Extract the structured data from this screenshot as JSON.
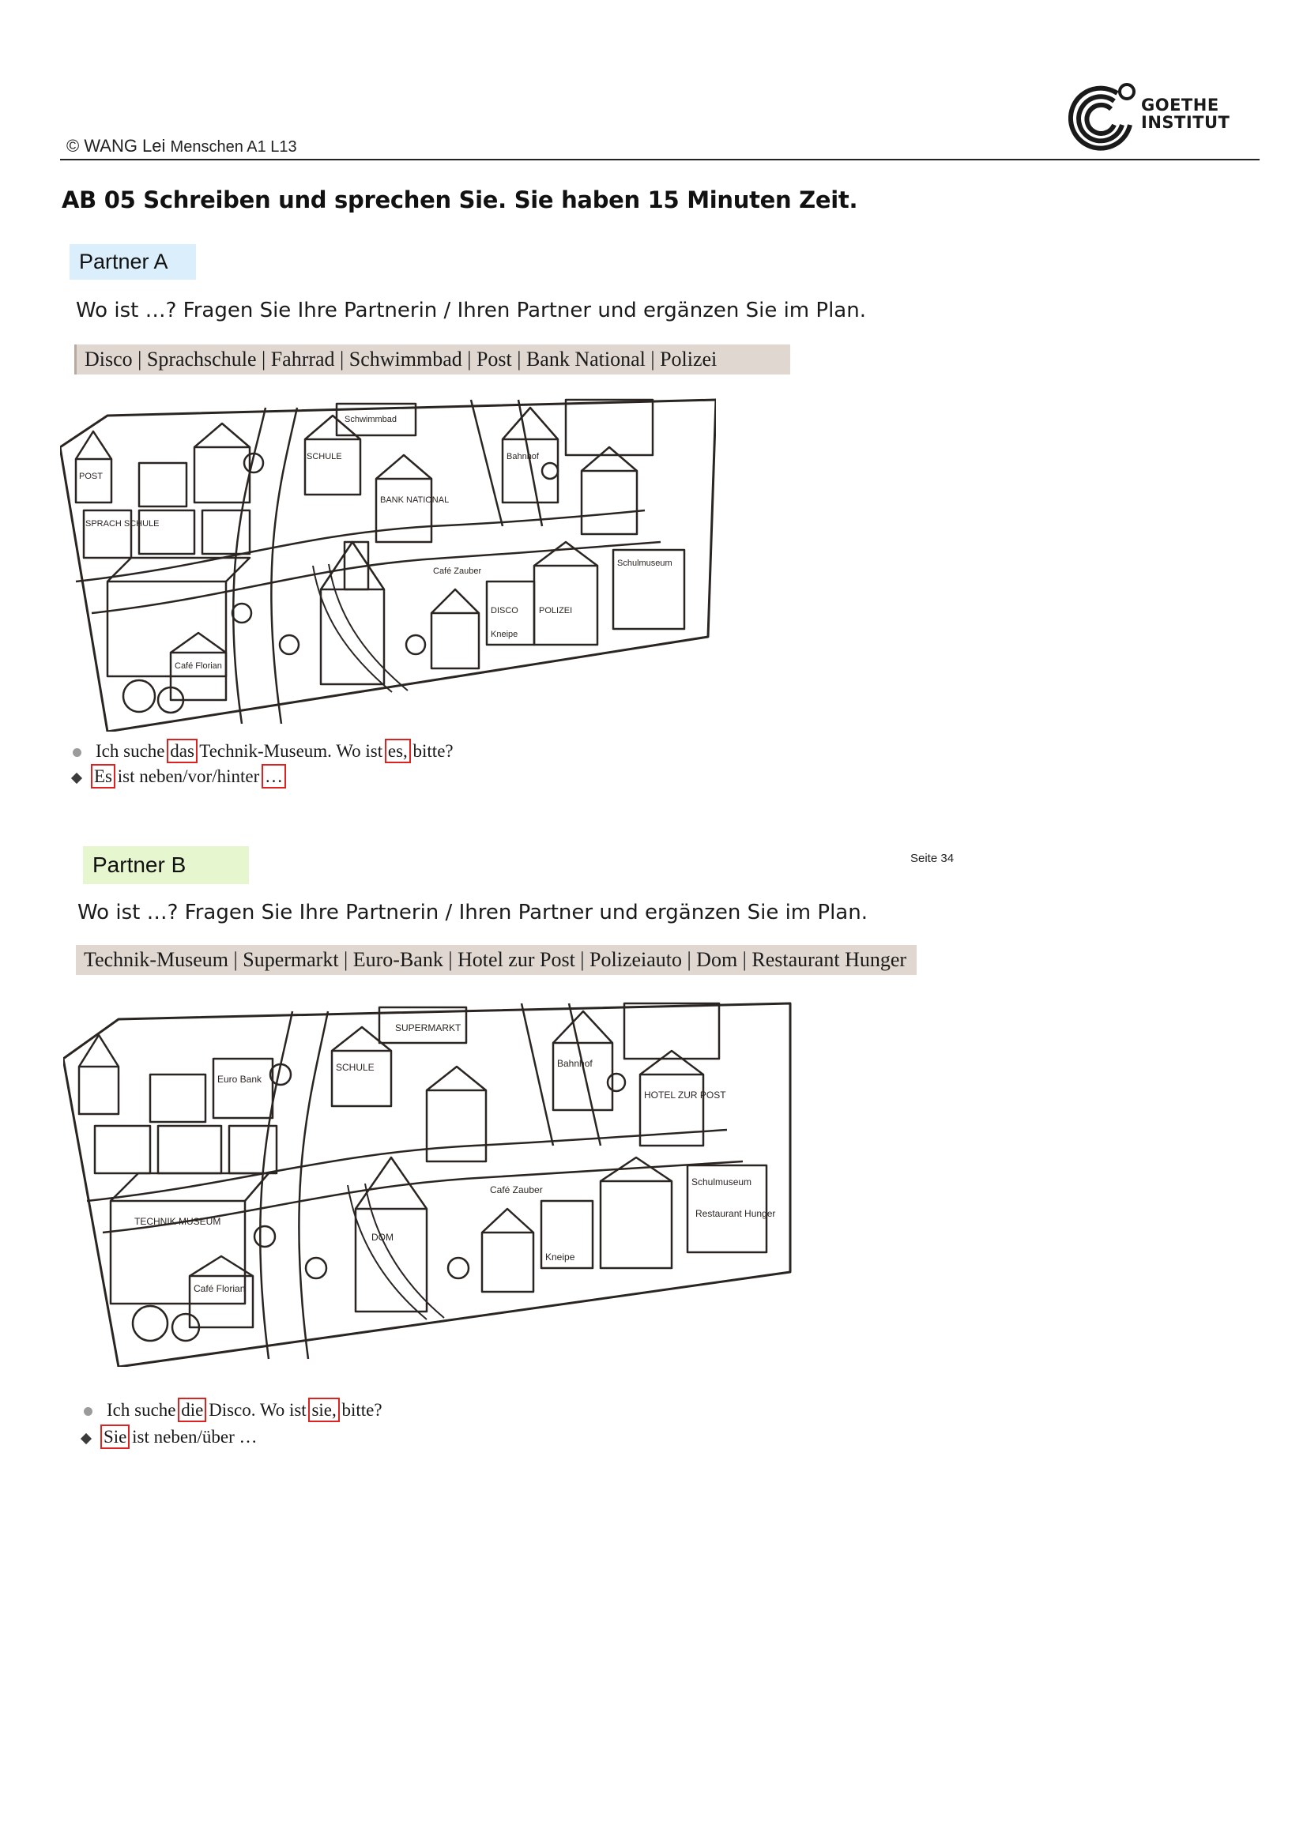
{
  "header": {
    "copyright": "© WANG Lei",
    "course": "Menschen A1 L13",
    "logo_line1": "GOETHE",
    "logo_line2": "INSTITUT"
  },
  "title": "AB 05 Schreiben und sprechen Sie. Sie haben 15  Minuten Zeit.",
  "partner_a": {
    "label": "Partner A",
    "instruction": "Wo ist …? Fragen Sie Ihre Partnerin / Ihren Partner und ergänzen Sie im Plan.",
    "words": "Disco | Sprachschule | Fahrrad | Schwimmbad | Post | Bank National | Polizei",
    "map_labels": [
      "POST",
      "SPRACH SCHULE",
      "SCHULE",
      "Schwimmbad",
      "BANK NATIONAL",
      "Café Zauber",
      "DISCO",
      "POLIZEI",
      "Kneipe",
      "Schulmuseum",
      "Café Florian",
      "Bahnhof"
    ],
    "dialog": {
      "q_pre": "Ich suche ",
      "q_art": "das",
      "q_mid": " Technik-Museum. Wo ist ",
      "q_pron": "es,",
      "q_post": " bitte?",
      "a_pron": "Es",
      "a_mid": " ist neben/vor/hinter ",
      "a_end": "…"
    }
  },
  "partner_b": {
    "label": "Partner B",
    "page_ref": "Seite 34",
    "instruction": "Wo ist …? Fragen Sie Ihre Partnerin / Ihren Partner und ergänzen Sie im Plan.",
    "words": "Technik-Museum | Supermarkt | Euro-Bank | Hotel zur Post | Polizeiauto | Dom | Restaurant Hunger",
    "map_labels": [
      "Euro Bank",
      "SCHULE",
      "SUPERMARKT",
      "TECHNIK MUSEUM",
      "Café Zauber",
      "DOM",
      "Kneipe",
      "Schulmuseum",
      "Restaurant Hunger",
      "HOTEL ZUR POST",
      "Café Florian",
      "Bahnhof"
    ],
    "dialog": {
      "q_pre": "Ich suche ",
      "q_art": "die",
      "q_mid": " Disco. Wo ist ",
      "q_pron": "sie,",
      "q_post": " bitte?",
      "a_pron": "Sie",
      "a_mid": " ist neben/über …"
    }
  }
}
